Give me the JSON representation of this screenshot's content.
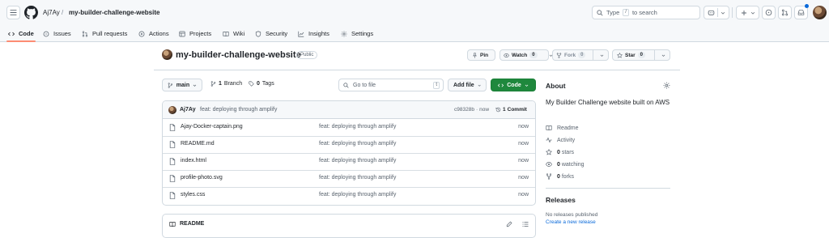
{
  "header": {
    "owner": "Aj7Ay",
    "separator": "/",
    "repo": "my-builder-challenge-website",
    "search_prefix": "Type",
    "search_key": "/",
    "search_suffix": "to search",
    "plus_label": "+"
  },
  "tabs": [
    {
      "label": "Code"
    },
    {
      "label": "Issues"
    },
    {
      "label": "Pull requests"
    },
    {
      "label": "Actions"
    },
    {
      "label": "Projects"
    },
    {
      "label": "Wiki"
    },
    {
      "label": "Security"
    },
    {
      "label": "Insights"
    },
    {
      "label": "Settings"
    }
  ],
  "repo": {
    "name": "my-builder-challenge-website",
    "visibility": "Public",
    "pin_label": "Pin",
    "watch_label": "Watch",
    "watch_count": "0",
    "fork_label": "Fork",
    "fork_count": "0",
    "star_label": "Star",
    "star_count": "0"
  },
  "toolbar": {
    "branch": "main",
    "branches_count": "1",
    "branches_label": "Branch",
    "tags_count": "0",
    "tags_label": "Tags",
    "goto_placeholder": "Go to file",
    "goto_key": "t",
    "add_file": "Add file",
    "code": "Code"
  },
  "latest_commit": {
    "author": "Aj7Ay",
    "message": "feat: deploying through amplify",
    "sha": "c98328b",
    "dot": "·",
    "time": "now",
    "commits_count": "1",
    "commits_label": "Commit"
  },
  "files": [
    {
      "name": "Ajay-Docker-captain.png",
      "message": "feat: deploying through amplify",
      "time": "now"
    },
    {
      "name": "README.md",
      "message": "feat: deploying through amplify",
      "time": "now"
    },
    {
      "name": "index.html",
      "message": "feat: deploying through amplify",
      "time": "now"
    },
    {
      "name": "profile-photo.svg",
      "message": "feat: deploying through amplify",
      "time": "now"
    },
    {
      "name": "styles.css",
      "message": "feat: deploying through amplify",
      "time": "now"
    }
  ],
  "readme": {
    "title": "README"
  },
  "about": {
    "title": "About",
    "description": "My Builder Challenge website built on AWS",
    "readme_label": "Readme",
    "activity_label": "Activity",
    "stars_count": "0",
    "stars_label": "stars",
    "watching_count": "0",
    "watching_label": "watching",
    "forks_count": "0",
    "forks_label": "forks"
  },
  "releases": {
    "title": "Releases",
    "empty_text": "No releases published",
    "create_link": "Create a new release"
  },
  "colors": {
    "accent_blue": "#0969da",
    "primary_green": "#1f883d",
    "tab_underline": "#fd8c73",
    "notification_dot": "#0969da"
  },
  "icons": [
    "menu-icon",
    "github-logo",
    "search-icon",
    "copilot-icon",
    "plus-icon",
    "issue-icon",
    "pull-request-icon",
    "inbox-icon",
    "code-icon",
    "play-icon",
    "table-icon",
    "book-icon",
    "shield-icon",
    "graph-icon",
    "gear-icon",
    "pin-icon",
    "eye-icon",
    "fork-icon",
    "star-icon",
    "branch-icon",
    "tag-icon",
    "file-icon",
    "history-icon",
    "pencil-icon",
    "list-icon",
    "pulse-icon"
  ]
}
